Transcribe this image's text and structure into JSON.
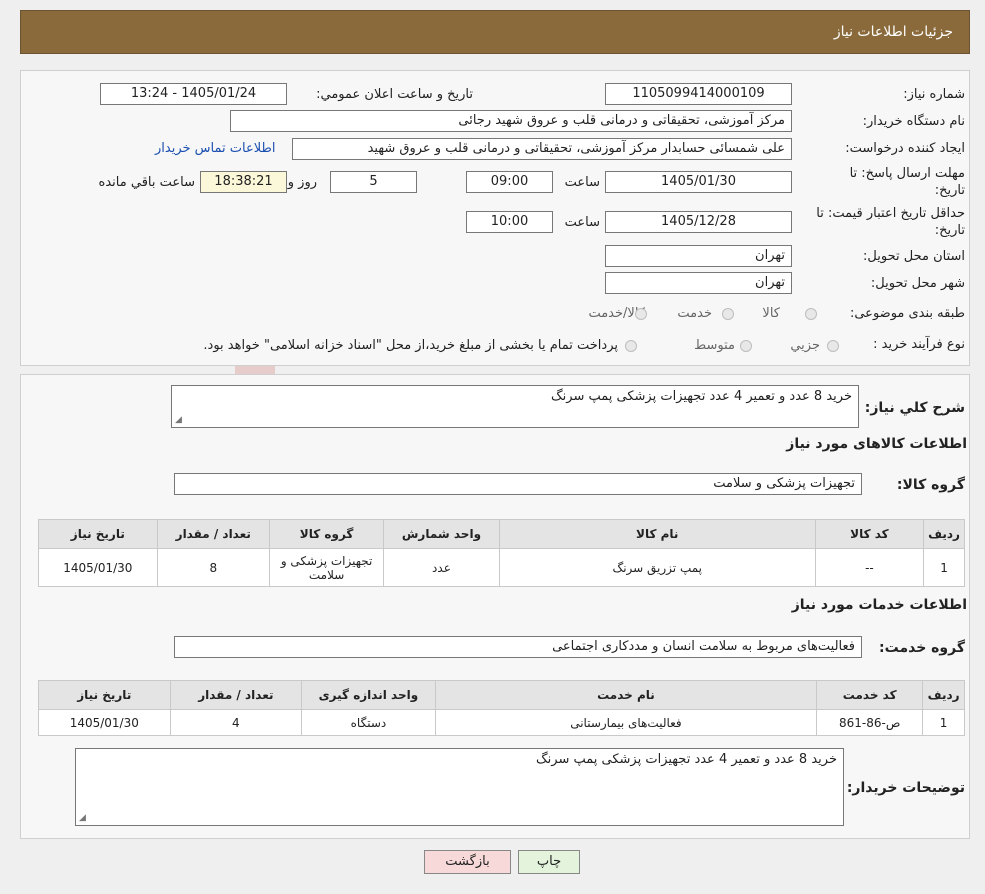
{
  "header": {
    "title": "جزئیات اطلاعات نیاز"
  },
  "info": {
    "need_number_label": "شماره نیاز:",
    "need_number": "1105099414000109",
    "announce_label": "تاریخ و ساعت اعلان عمومي:",
    "announce_value": "1405/01/24 - 13:24",
    "buyer_org_label": "نام دستگاه خریدار:",
    "buyer_org": "مرکز آموزشی، تحقیقاتی و درمانی قلب و عروق شهید رجائی",
    "requester_label": "ایجاد کننده درخواست:",
    "requester": "علی شمسائی حسابدار مرکز آموزشی، تحقیقاتی و درمانی قلب و عروق شهید",
    "contact_link": "اطلاعات تماس خریدار",
    "deadline_label_1": "مهلت ارسال پاسخ: تا",
    "deadline_label_2": "تاریخ:",
    "deadline_date": "1405/01/30",
    "time_label": "ساعت",
    "deadline_time": "09:00",
    "days_value": "5",
    "days_label": "روز و",
    "remaining_time": "18:38:21",
    "remaining_label": "ساعت باقي مانده",
    "validity_label_1": "حداقل تاریخ اعتبار قیمت: تا",
    "validity_label_2": "تاریخ:",
    "validity_date": "1405/12/28",
    "validity_time": "10:00",
    "province_label": "استان محل تحویل:",
    "province": "تهران",
    "city_label": "شهر محل تحویل:",
    "city": "تهران",
    "category_label": "طبقه بندی موضوعی:",
    "category_options": [
      "کالا",
      "خدمت",
      "کالا/خدمت"
    ],
    "process_label": "نوع فرآیند خرید :",
    "process_options": [
      "جزیي",
      "متوسط"
    ],
    "process_note": "پرداخت تمام یا بخشی از مبلغ خرید،از محل \"اسناد خزانه اسلامی\" خواهد بود."
  },
  "details": {
    "general_desc_label": "شرح کلي نیاز:",
    "general_desc": "خرید 8 عدد و تعمیر 4 عدد تجهیزات پزشکی پمپ سرنگ",
    "goods_title": "اطلاعات کالاهای مورد نیاز",
    "goods_group_label": "گروه کالا:",
    "goods_group": "تجهیزات پزشکی و سلامت",
    "goods_headers": [
      "ردیف",
      "کد کالا",
      "نام کالا",
      "واحد شمارش",
      "گروه کالا",
      "تعداد / مقدار",
      "تاریخ نیاز"
    ],
    "goods_rows": [
      [
        "1",
        "--",
        "پمپ تزریق سرنگ",
        "عدد",
        "تجهیزات پزشکی و سلامت",
        "8",
        "1405/01/30"
      ]
    ],
    "services_title": "اطلاعات خدمات مورد نیاز",
    "service_group_label": "گروه خدمت:",
    "service_group": "فعالیت‌های مربوط به سلامت انسان و مددکاری اجتماعی",
    "service_headers": [
      "ردیف",
      "کد خدمت",
      "نام خدمت",
      "واحد اندازه گیری",
      "تعداد / مقدار",
      "تاریخ نیاز"
    ],
    "service_rows": [
      [
        "1",
        "ص-86-861",
        "فعالیت‌های بیمارستانی",
        "دستگاه",
        "4",
        "1405/01/30"
      ]
    ],
    "buyer_notes_label": "توضیحات خریدار:",
    "buyer_notes": "خرید 8 عدد و تعمیر 4 عدد تجهیزات پزشکی پمپ سرنگ"
  },
  "buttons": {
    "print": "چاپ",
    "back": "بازگشت"
  },
  "colors": {
    "header_bg": "#8a6a3b",
    "link": "#1a4fb0",
    "back_btn": "#f8d9d9",
    "print_btn": "#e4f4dc"
  }
}
